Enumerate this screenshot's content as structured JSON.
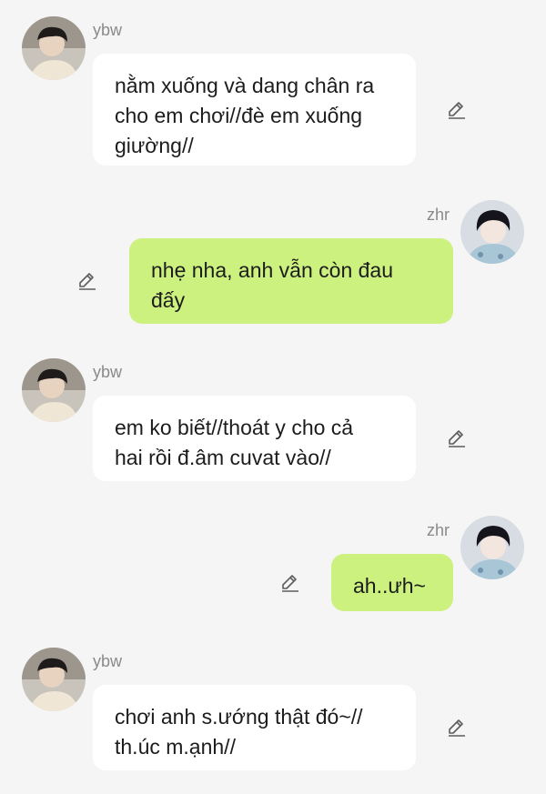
{
  "users": {
    "left": {
      "name": "ybw",
      "avatar": "avatar-ybw"
    },
    "right": {
      "name": "zhr",
      "avatar": "avatar-zhr"
    }
  },
  "messages": [
    {
      "side": "left",
      "sender": "ybw",
      "text": "nằm xuống và dang chân ra\ncho em chơi//đè em xuống\ngiường//"
    },
    {
      "side": "right",
      "sender": "zhr",
      "text": "nhẹ nha, anh vẫn còn đau\nđấy"
    },
    {
      "side": "left",
      "sender": "ybw",
      "text": "em ko biết//thoát y cho cả\nhai rồi đ.âm cuvat vào//"
    },
    {
      "side": "right",
      "sender": "zhr",
      "text": "ah..ưh~"
    },
    {
      "side": "left",
      "sender": "ybw",
      "text": "chơi anh s.ướng thật đó~//\nth.úc m.ạnh//"
    }
  ],
  "icons": {
    "edit": "pencil-edit-icon"
  },
  "colors": {
    "background": "#f5f5f5",
    "left_bubble": "#ffffff",
    "right_bubble": "#ccf17f",
    "name": "#8a8a8a"
  }
}
